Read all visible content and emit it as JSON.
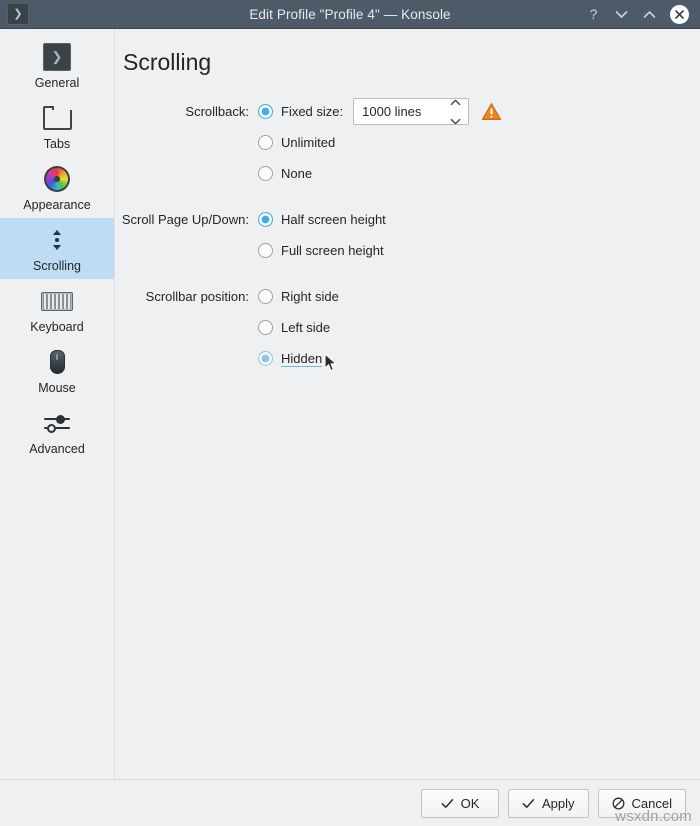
{
  "window": {
    "title": "Edit Profile \"Profile 4\" — Konsole",
    "app_icon": "terminal-icon",
    "titlebar_color": "#4d5b68",
    "buttons": {
      "help": "?",
      "minimize": "minimize",
      "maximize": "maximize",
      "close": "close"
    }
  },
  "sidebar": {
    "items": [
      {
        "label": "General",
        "icon": "terminal-icon",
        "selected": false
      },
      {
        "label": "Tabs",
        "icon": "folder-tab-icon",
        "selected": false
      },
      {
        "label": "Appearance",
        "icon": "color-wheel-icon",
        "selected": false
      },
      {
        "label": "Scrolling",
        "icon": "scroll-icon",
        "selected": true
      },
      {
        "label": "Keyboard",
        "icon": "keyboard-icon",
        "selected": false
      },
      {
        "label": "Mouse",
        "icon": "mouse-icon",
        "selected": false
      },
      {
        "label": "Advanced",
        "icon": "sliders-icon",
        "selected": false
      }
    ],
    "selected_color": "#bedcf3"
  },
  "main": {
    "page_title": "Scrolling",
    "groups": [
      {
        "label": "Scrollback:",
        "options": [
          {
            "label": "Fixed size:",
            "checked": true,
            "state": "on"
          },
          {
            "label": "Unlimited",
            "checked": false,
            "state": "off"
          },
          {
            "label": "None",
            "checked": false,
            "state": "off"
          }
        ],
        "spinbox": {
          "value": "1000 lines",
          "up_icon": "chevron-up-icon",
          "down_icon": "chevron-down-icon"
        },
        "warning": {
          "icon": "warning-triangle-icon",
          "color": "#e8861e"
        }
      },
      {
        "label": "Scroll Page Up/Down:",
        "options": [
          {
            "label": "Half screen height",
            "checked": true,
            "state": "on"
          },
          {
            "label": "Full screen height",
            "checked": false,
            "state": "off"
          }
        ]
      },
      {
        "label": "Scrollbar position:",
        "options": [
          {
            "label": "Right side",
            "checked": false,
            "state": "off"
          },
          {
            "label": "Left side",
            "checked": false,
            "state": "off"
          },
          {
            "label": "Hidden",
            "checked": true,
            "state": "on-hover"
          }
        ]
      }
    ],
    "accent_color": "#3daee9"
  },
  "footer": {
    "buttons": [
      {
        "label": "OK",
        "icon": "check-icon"
      },
      {
        "label": "Apply",
        "icon": "check-icon"
      },
      {
        "label": "Cancel",
        "icon": "cancel-icon"
      }
    ]
  },
  "watermark": {
    "text": "wsxdn.com"
  }
}
